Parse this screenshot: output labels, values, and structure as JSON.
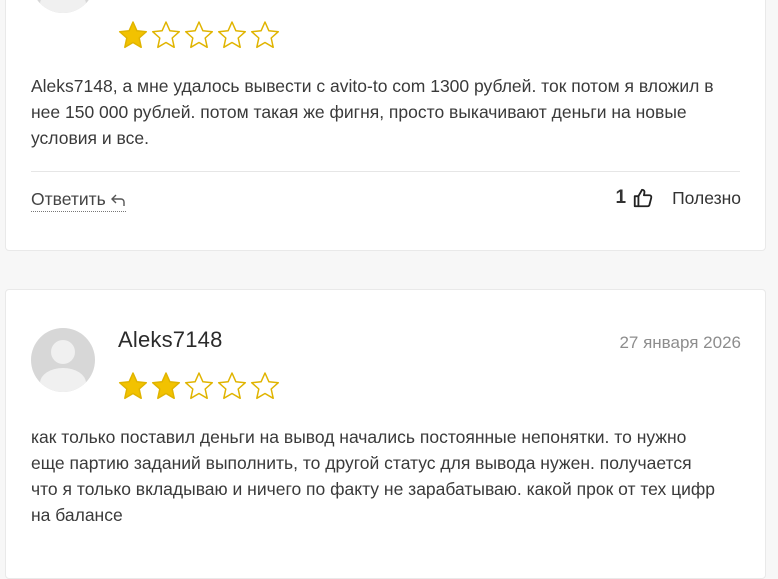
{
  "colors": {
    "star_filled": "#f2c200",
    "star_outline": "#e0b400",
    "background": "#f7f7f7",
    "card": "#ffffff"
  },
  "reviews": [
    {
      "rating": 1,
      "max_rating": 5,
      "text": "Aleks7148, а мне удалось вывести с avito-to com 1300 рублей. ток потом я вложил в нее 150 000 рублей. потом такая же фигня, просто выкачивают деньги на новые условия и все.",
      "reply_label": "Ответить",
      "useful_count": "1",
      "useful_label": "Полезно"
    },
    {
      "author": "Aleks7148",
      "date": "27 января 2026",
      "rating": 2,
      "max_rating": 5,
      "text": "как только поставил деньги на вывод начались постоянные непонятки. то нужно еще партию заданий выполнить, то другой статус для вывода нужен. получается что я только вкладываю и ничего по факту не зарабатываю. какой прок от тех цифр на балансе"
    }
  ],
  "icons": {
    "avatar": "user-avatar-placeholder",
    "reply": "reply-arrow-icon",
    "thumb": "thumbs-up-icon",
    "star": "star-icon"
  }
}
